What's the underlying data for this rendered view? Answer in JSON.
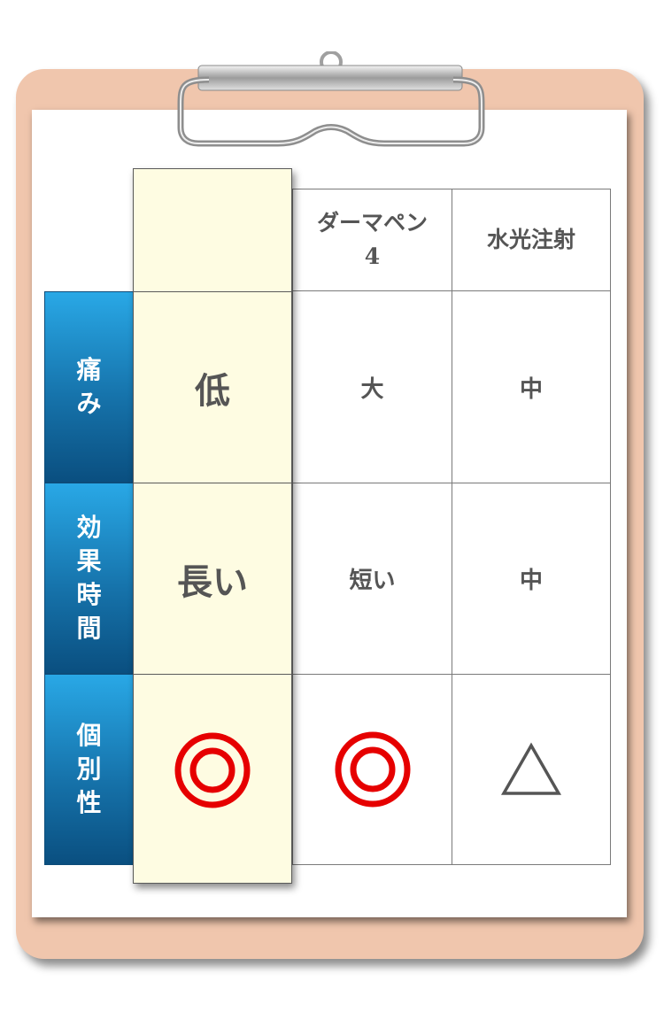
{
  "table": {
    "columns": [
      "",
      "ダーマペン\n4",
      "水光注射"
    ],
    "rows": [
      {
        "label": "痛\nみ",
        "values": [
          "低",
          "大",
          "中"
        ]
      },
      {
        "label": "効\n果\n時\n間",
        "values": [
          "長い",
          "短い",
          "中"
        ]
      },
      {
        "label": "個\n別\n性",
        "values": [
          "◎",
          "◎",
          "△"
        ]
      }
    ]
  },
  "colors": {
    "board": "#f0c6ad",
    "highlight": "#fefce2",
    "row_header_top": "#29a8e6",
    "row_header_bottom": "#0a4f80",
    "double_circle": "#e60000",
    "triangle": "#555555"
  },
  "icons": {
    "clip": "clipboard-clip-icon",
    "double_circle": "double-circle-icon",
    "triangle": "triangle-icon"
  }
}
